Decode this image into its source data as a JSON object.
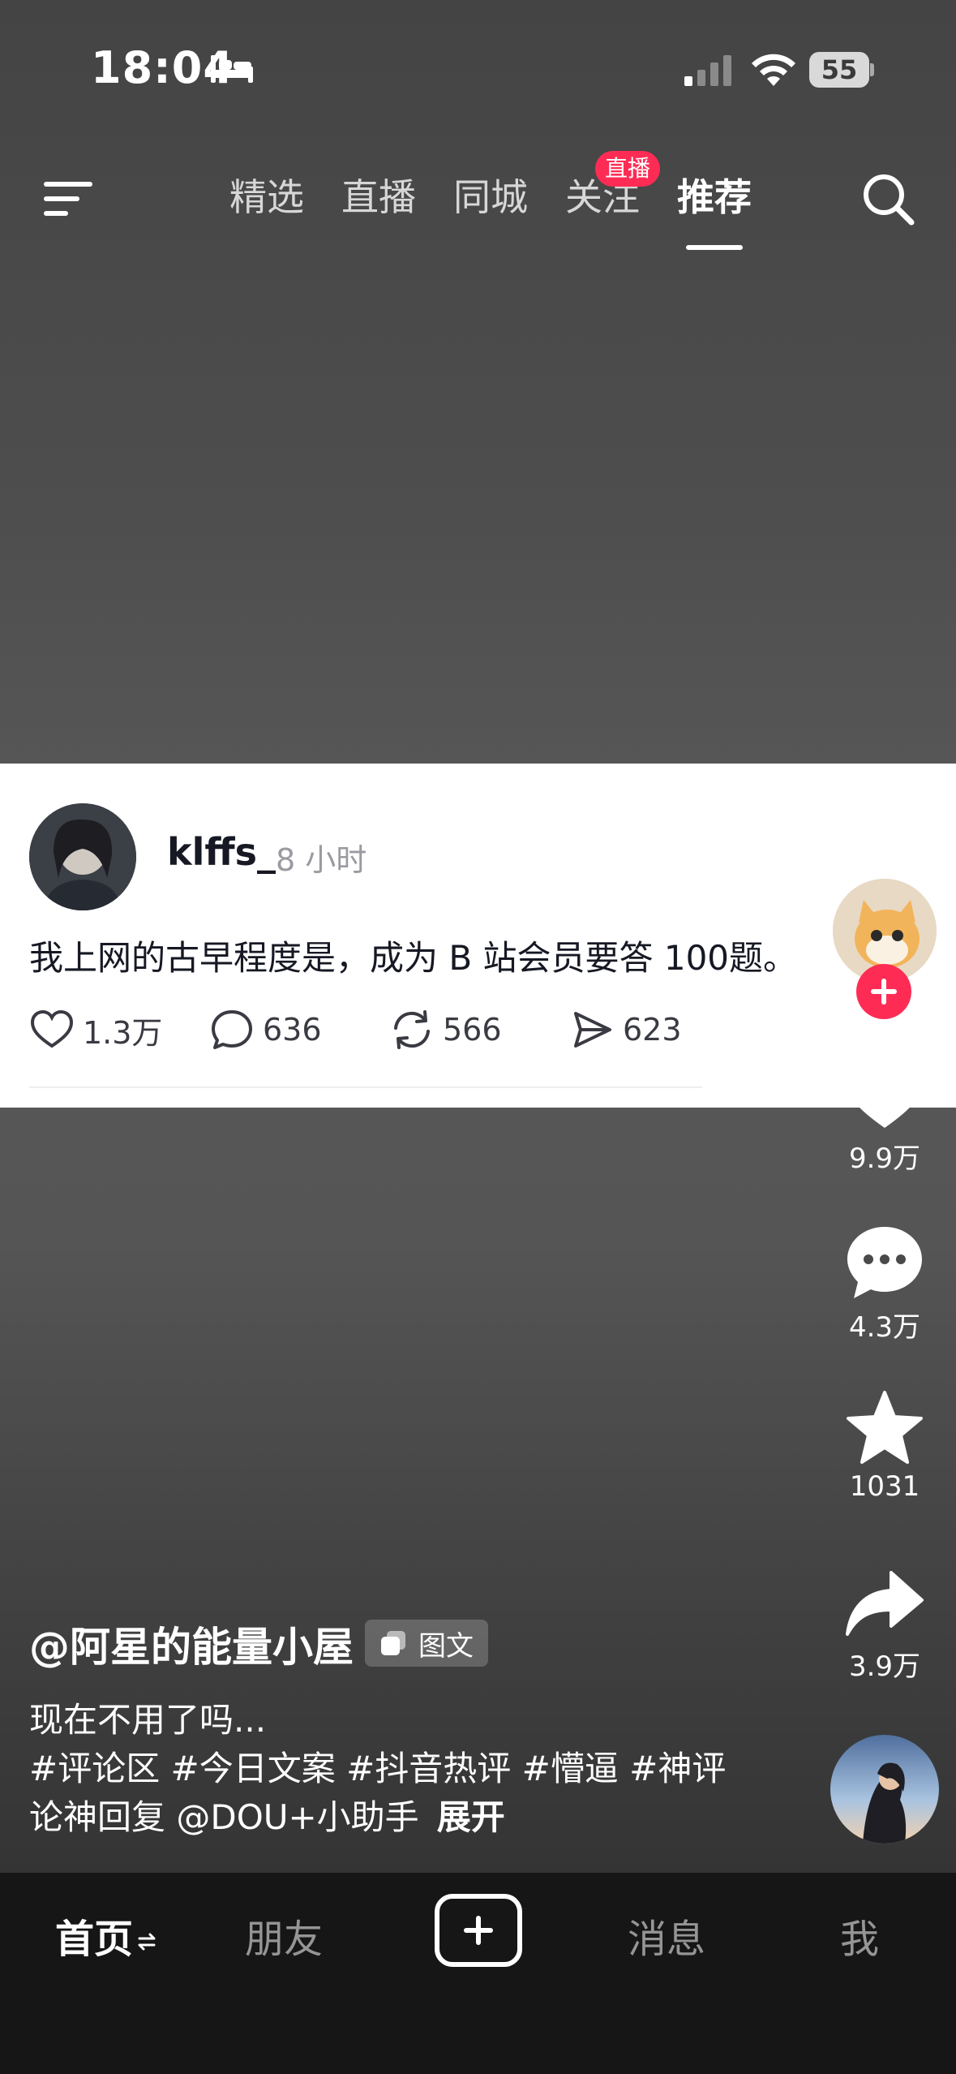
{
  "status_bar": {
    "time": "18:04",
    "sleep_icon": "bed-icon",
    "signal_icon": "cellular-signal-icon",
    "wifi_icon": "wifi-icon",
    "battery": "55"
  },
  "top_nav": {
    "menu_icon": "hamburger-menu-icon",
    "tabs": [
      {
        "label": "精选"
      },
      {
        "label": "直播"
      },
      {
        "label": "同城"
      },
      {
        "label": "关注",
        "badge": "直播"
      },
      {
        "label": "推荐",
        "active": true
      }
    ],
    "search_icon": "search-icon"
  },
  "post_card": {
    "username": "klffs_",
    "time": "8 小时",
    "text": "我上网的古早程度是，成为 B 站会员要答 100题。",
    "stats": {
      "likes": "1.3万",
      "comments": "636",
      "reposts": "566",
      "shares": "623"
    }
  },
  "right_rail": {
    "likes": "9.9万",
    "comments": "4.3万",
    "favorites": "1031",
    "shares": "3.9万"
  },
  "caption": {
    "author": "@阿星的能量小屋",
    "type_badge": "图文",
    "line1": "现在不用了吗...",
    "line2": "#评论区 #今日文案 #抖音热评 #懵逼 #神评",
    "line3": "论神回复 @DOU+小助手",
    "expand": "展开"
  },
  "tab_bar": {
    "home": "首页",
    "friends": "朋友",
    "messages": "消息",
    "me": "我"
  },
  "colors": {
    "accent": "#fe2c55",
    "tab_bar_bg": "#161616",
    "card_bg": "#ffffff"
  }
}
